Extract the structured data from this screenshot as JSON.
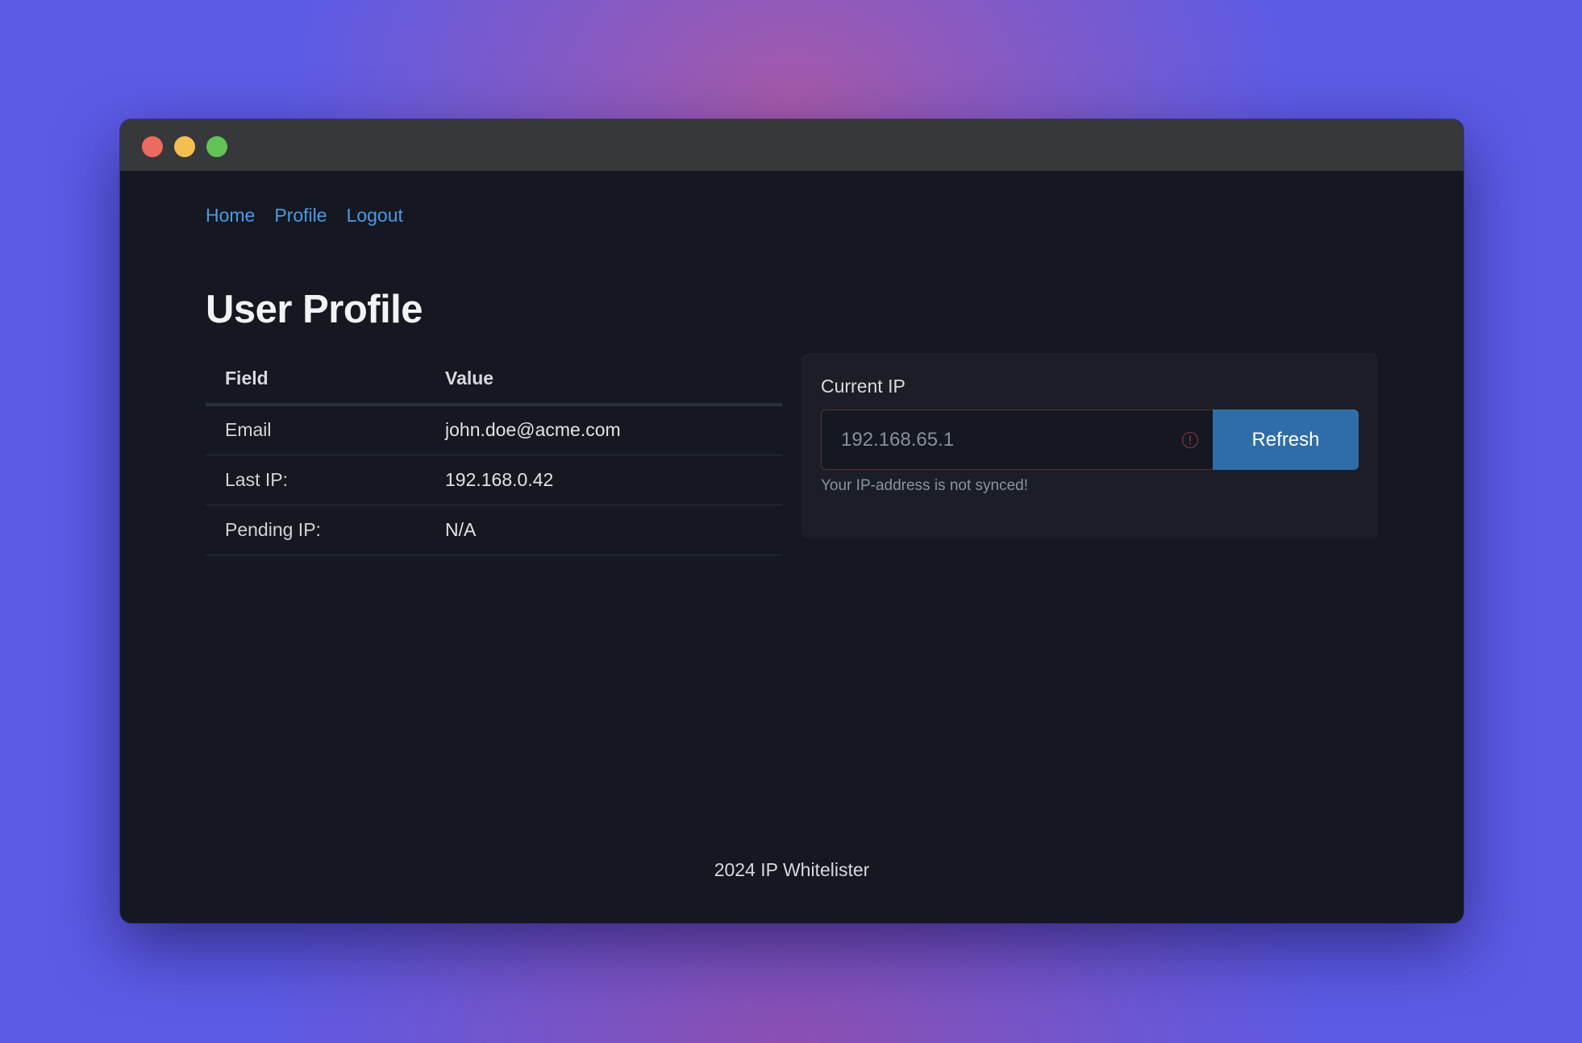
{
  "nav": {
    "items": [
      {
        "label": "Home"
      },
      {
        "label": "Profile"
      },
      {
        "label": "Logout"
      }
    ]
  },
  "page": {
    "title": "User Profile"
  },
  "table": {
    "headers": {
      "field": "Field",
      "value": "Value"
    },
    "rows": [
      {
        "field": "Email",
        "value": "john.doe@acme.com"
      },
      {
        "field": "Last IP:",
        "value": "192.168.0.42"
      },
      {
        "field": "Pending IP:",
        "value": "N/A"
      }
    ]
  },
  "ip_panel": {
    "label": "Current IP",
    "input_value": "192.168.65.1",
    "warning_icon": "exclamation-circle-icon",
    "button_label": "Refresh",
    "note": "Your IP-address is not synced!"
  },
  "footer": {
    "text": "2024 IP Whitelister"
  },
  "colors": {
    "accent": "#2f6da8",
    "link": "#4b9ae6",
    "invalid_border": "#5a2e37"
  }
}
